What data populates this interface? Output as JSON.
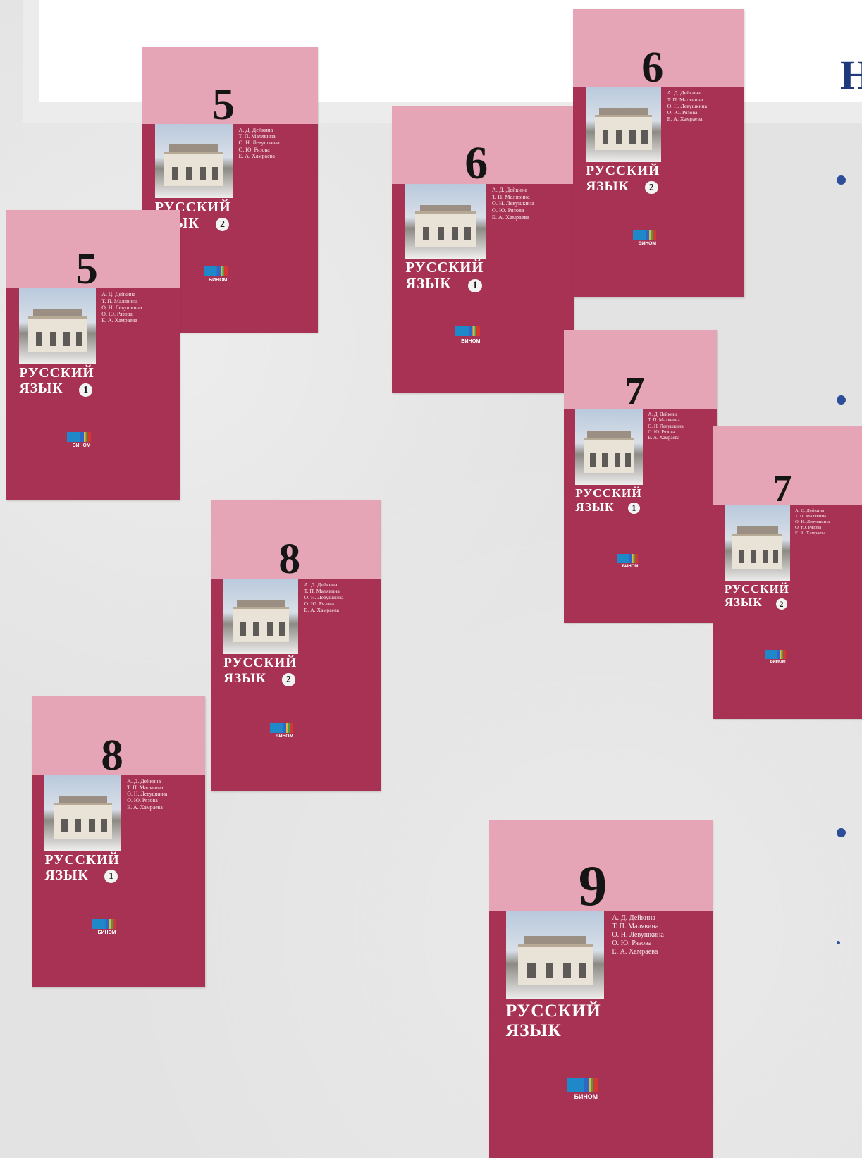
{
  "slide": {
    "title": "Н"
  },
  "books": [
    {
      "id": "5-2",
      "grade": "5",
      "part": "2",
      "authors": [
        "А. Д. Дейкина",
        "Т. П. Малявина",
        "О. Н. Левушкина",
        "О. Ю. Рязова",
        "Е. А. Хамраева"
      ],
      "title_line1": "РУССКИЙ",
      "title_line2": "ЯЗЫК",
      "publisher": "БИНОМ"
    },
    {
      "id": "5-1",
      "grade": "5",
      "part": "1",
      "authors": [
        "А. Д. Дейкина",
        "Т. П. Малявина",
        "О. Н. Левушкина",
        "О. Ю. Рязова",
        "Е. А. Хамраева"
      ],
      "title_line1": "РУССКИЙ",
      "title_line2": "ЯЗЫК",
      "publisher": "БИНОМ"
    },
    {
      "id": "6-1",
      "grade": "6",
      "part": "1",
      "authors": [
        "А. Д. Дейкина",
        "Т. П. Малявина",
        "О. Н. Левушкина",
        "О. Ю. Рязова",
        "Е. А. Хамраева"
      ],
      "title_line1": "РУССКИЙ",
      "title_line2": "ЯЗЫК",
      "publisher": "БИНОМ"
    },
    {
      "id": "6-2",
      "grade": "6",
      "part": "2",
      "authors": [
        "А. Д. Дейкина",
        "Т. П. Малявина",
        "О. Н. Левушкина",
        "О. Ю. Рязова",
        "Е. А. Хамраева"
      ],
      "title_line1": "РУССКИЙ",
      "title_line2": "ЯЗЫК",
      "publisher": "БИНОМ"
    },
    {
      "id": "7-1",
      "grade": "7",
      "part": "1",
      "authors": [
        "А. Д. Дейкина",
        "Т. П. Малявина",
        "О. Н. Левушкина",
        "О. Ю. Рязова",
        "Е. А. Хамраева"
      ],
      "title_line1": "РУССКИЙ",
      "title_line2": "ЯЗЫК",
      "publisher": "БИНОМ"
    },
    {
      "id": "7-2",
      "grade": "7",
      "part": "2",
      "authors": [
        "А. Д. Дейкина",
        "Т. П. Малявина",
        "О. Н. Левушкина",
        "О. Ю. Рязова",
        "Е. А. Хамраева"
      ],
      "title_line1": "РУССКИЙ",
      "title_line2": "ЯЗЫК",
      "publisher": "БИНОМ"
    },
    {
      "id": "8-2",
      "grade": "8",
      "part": "2",
      "authors": [
        "А. Д. Дейкина",
        "Т. П. Малявина",
        "О. Н. Левушкина",
        "О. Ю. Рязова",
        "Е. А. Хамраева"
      ],
      "title_line1": "РУССКИЙ",
      "title_line2": "ЯЗЫК",
      "publisher": "БИНОМ"
    },
    {
      "id": "8-1",
      "grade": "8",
      "part": "1",
      "authors": [
        "А. Д. Дейкина",
        "Т. П. Малявина",
        "О. Н. Левушкина",
        "О. Ю. Рязова",
        "Е. А. Хамраева"
      ],
      "title_line1": "РУССКИЙ",
      "title_line2": "ЯЗЫК",
      "publisher": "БИНОМ"
    },
    {
      "id": "9",
      "grade": "9",
      "part": "",
      "authors": [
        "А. Д. Дейкина",
        "Т. П. Малявина",
        "О. Н. Левушкина",
        "О. Ю. Рязова",
        "Е. А. Хамраева"
      ],
      "title_line1": "РУССКИЙ",
      "title_line2": "ЯЗЫК",
      "publisher": "БИНОМ"
    }
  ],
  "colors": {
    "cover_body": "#a73253",
    "cover_top": "#e6a5b6",
    "title_text": "#1f3a7a",
    "bullet": "#2d4f9a"
  }
}
